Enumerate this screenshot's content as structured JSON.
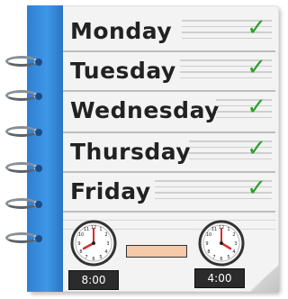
{
  "days": [
    {
      "label": "Monday"
    },
    {
      "label": "Tuesday"
    },
    {
      "label": "Wednesday"
    },
    {
      "label": "Thursday"
    },
    {
      "label": "Friday"
    }
  ],
  "check_symbol": "✓",
  "schedule": {
    "start_time": "8:00",
    "end_time": "4:00"
  },
  "colors": {
    "spine": "#3f97e6",
    "check": "#2aa02a",
    "time_bar": "#f6c9a8",
    "clock_hand": "#d92b2b"
  },
  "icons": [
    "ring-binder",
    "check-icon",
    "clock-icon"
  ]
}
